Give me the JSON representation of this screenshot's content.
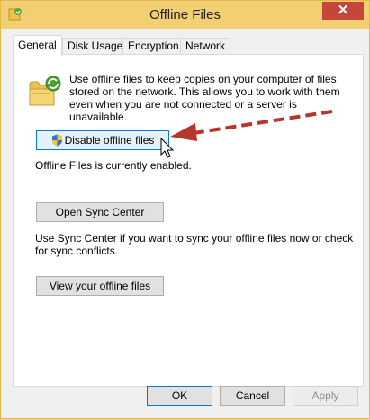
{
  "window": {
    "title": "Offline Files",
    "close_glyph": "✕",
    "icons": {
      "app": "offline-files-app-icon",
      "close": "close-icon"
    }
  },
  "tabs": [
    {
      "label": "General",
      "active": true
    },
    {
      "label": "Disk Usage",
      "active": false
    },
    {
      "label": "Encryption",
      "active": false
    },
    {
      "label": "Network",
      "active": false
    }
  ],
  "general": {
    "intro_text": "Use offline files to keep copies on your computer of files stored on the network.  This allows you to work with them even when you are not connected or a server is unavailable.",
    "disable_button": "Disable offline files",
    "status_text": "Offline Files is currently enabled.",
    "sync_center_button": "Open Sync Center",
    "sync_description": "Use Sync Center if you want to sync your offline files now or check for sync conflicts.",
    "view_files_button": "View your offline files",
    "icons": {
      "folder": "sync-folder-icon",
      "shield": "uac-shield-icon",
      "cursor": "mouse-pointer-icon",
      "annotation": "red-dashed-arrow"
    }
  },
  "footer": {
    "ok": "OK",
    "cancel": "Cancel",
    "apply": "Apply",
    "apply_enabled": false
  },
  "colors": {
    "titlebar": "#f3cf73",
    "close": "#c7463c",
    "focus_border": "#0078d7",
    "annotation_arrow": "#b5372a"
  }
}
